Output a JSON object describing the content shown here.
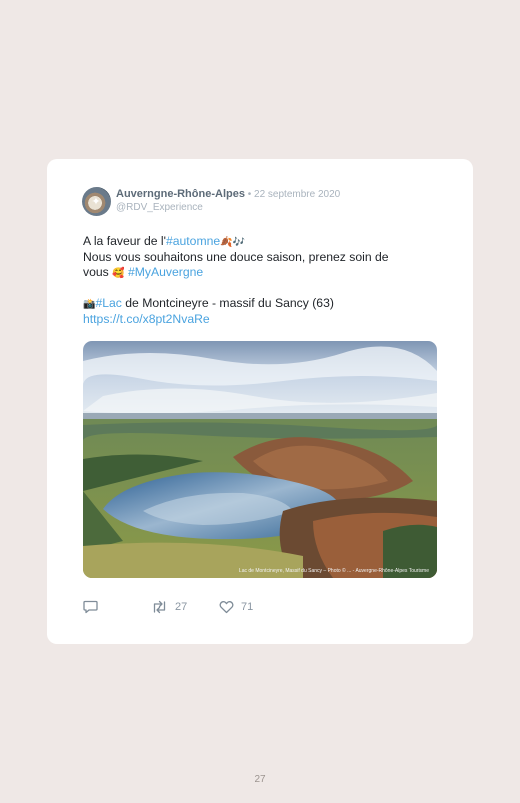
{
  "tweet": {
    "author_name": "Auverngne-Rhône-Alpes",
    "date": " • 22 septembre 2020",
    "handle": "@RDV_Experience",
    "line1_prefix": "A la faveur de l'",
    "line1_hashtag": "#automne",
    "line1_emoji": "🍂🎶",
    "line2": "Nous vous souhaitons une douce saison, prenez soin de",
    "line3_prefix": "vous ",
    "line3_emoji": "🥰",
    "line3_hashtag": " #MyAuvergne",
    "line4_emoji": "📸",
    "line4_hashtag": "#Lac",
    "line4_rest": " de Montcineyre - massif du Sancy (63)",
    "line5_link": "https://t.co/x8pt2NvaRe",
    "photo_credit": "Lac de Montcineyre, Massif du Sancy – Photo © ... - Auvergne-Rhône-Alpes Tourisme",
    "retweet_count": "27",
    "like_count": "71"
  },
  "icons": {
    "reply": "reply-icon",
    "retweet": "retweet-icon",
    "like": "heart-icon",
    "avatar": "avatar"
  },
  "colors": {
    "background": "#efe8e6",
    "link": "#4aa3df",
    "author": "#5d6b78",
    "meta": "#a9b3bd"
  },
  "page": {
    "number": "27"
  }
}
